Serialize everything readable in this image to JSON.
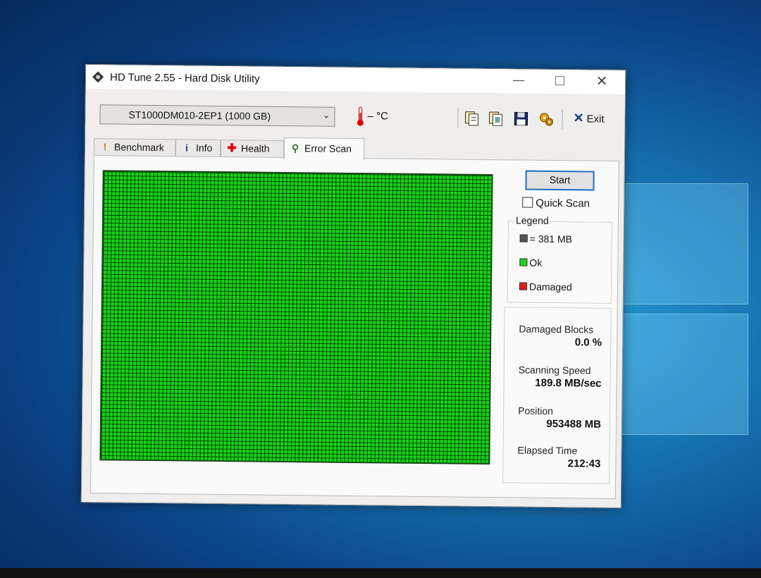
{
  "window": {
    "title": "HD Tune 2.55 - Hard Disk Utility"
  },
  "toolbar": {
    "drive": "ST1000DM010-2EP1 (1000 GB)",
    "temperature": "– °C",
    "exit_label": "Exit"
  },
  "tabs": [
    {
      "label": "Benchmark",
      "icon": "benchmark-icon"
    },
    {
      "label": "Info",
      "icon": "info-icon"
    },
    {
      "label": "Health",
      "icon": "health-icon"
    },
    {
      "label": "Error Scan",
      "icon": "magnifier-icon",
      "active": true
    }
  ],
  "scan": {
    "start_label": "Start",
    "quick_scan_label": "Quick Scan",
    "quick_scan_checked": false,
    "block_status": "all ok",
    "colors": {
      "ok": "#17d517",
      "damaged": "#e02020",
      "block": "#444444"
    }
  },
  "legend": {
    "title": "Legend",
    "block_size": "= 381 MB",
    "ok": "Ok",
    "damaged": "Damaged"
  },
  "stats": {
    "damaged_blocks_label": "Damaged Blocks",
    "damaged_blocks_value": "0.0 %",
    "speed_label": "Scanning Speed",
    "speed_value": "189.8 MB/sec",
    "position_label": "Position",
    "position_value": "953488 MB",
    "elapsed_label": "Elapsed Time",
    "elapsed_value": "212:43"
  }
}
